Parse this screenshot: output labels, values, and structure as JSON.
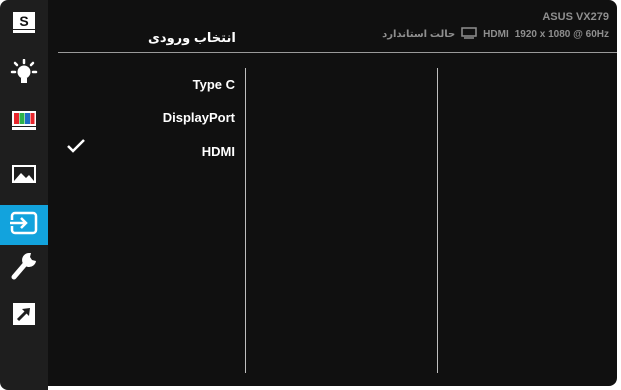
{
  "header": {
    "title": "انتخاب ورودی",
    "model": "ASUS VX279",
    "resolution": "1920 x 1080 @ 60Hz",
    "input": "HDMI",
    "mode_label": "حالت استاندارد"
  },
  "sidebar": {
    "items": [
      {
        "name": "splendid-icon",
        "label": "S"
      },
      {
        "name": "brightness-icon"
      },
      {
        "name": "color-icon"
      },
      {
        "name": "image-icon"
      },
      {
        "name": "input-select-icon",
        "active": true
      },
      {
        "name": "system-setup-icon"
      },
      {
        "name": "shortcut-icon"
      }
    ]
  },
  "menu": {
    "items": [
      {
        "label": "Type C",
        "selected": false
      },
      {
        "label": "DisplayPort",
        "selected": false
      },
      {
        "label": "HDMI",
        "selected": true
      }
    ]
  },
  "colors": {
    "sidebar_bg": "#1e1e1e",
    "main_bg": "#101010",
    "accent": "#12a3dd",
    "text": "#ffffff",
    "muted": "#8f8f8f"
  }
}
